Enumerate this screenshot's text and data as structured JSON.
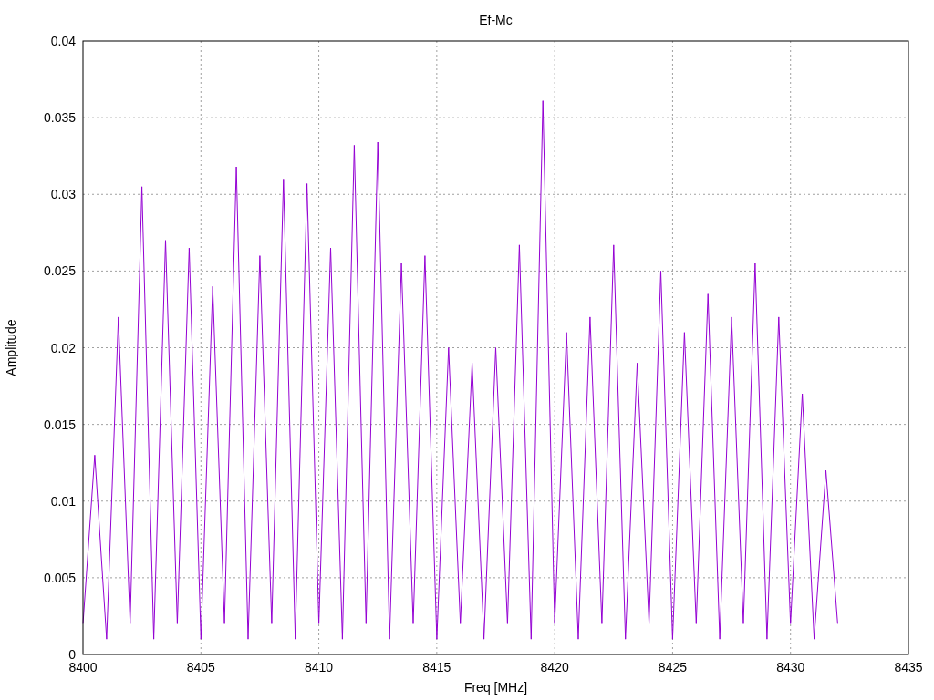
{
  "chart_data": {
    "type": "line",
    "title": "Ef-Mc",
    "xlabel": "Freq [MHz]",
    "ylabel": "Amplitude",
    "grid": true,
    "xlim": [
      8400,
      8435
    ],
    "ylim": [
      0,
      0.04
    ],
    "xticks": [
      8400,
      8405,
      8410,
      8415,
      8420,
      8425,
      8430,
      8435
    ],
    "yticks": [
      {
        "value": 0,
        "label": "0"
      },
      {
        "value": 0.005,
        "label": "0.005"
      },
      {
        "value": 0.01,
        "label": "0.01"
      },
      {
        "value": 0.015,
        "label": "0.015"
      },
      {
        "value": 0.02,
        "label": "0.02"
      },
      {
        "value": 0.025,
        "label": "0.025"
      },
      {
        "value": 0.03,
        "label": "0.03"
      },
      {
        "value": 0.035,
        "label": "0.035"
      },
      {
        "value": 0.04,
        "label": "0.04"
      }
    ],
    "x": [
      8400,
      8400.5,
      8401,
      8401.5,
      8402,
      8402.5,
      8403,
      8403.5,
      8404,
      8404.5,
      8405,
      8405.5,
      8406,
      8406.5,
      8407,
      8407.5,
      8408,
      8408.5,
      8409,
      8409.5,
      8410,
      8410.5,
      8411,
      8411.5,
      8412,
      8412.5,
      8413,
      8413.5,
      8414,
      8414.5,
      8415,
      8415.5,
      8416,
      8416.5,
      8417,
      8417.5,
      8418,
      8418.5,
      8419,
      8419.5,
      8420,
      8420.5,
      8421,
      8421.5,
      8422,
      8422.5,
      8423,
      8423.5,
      8424,
      8424.5,
      8425,
      8425.5,
      8426,
      8426.5,
      8427,
      8427.5,
      8428,
      8428.5,
      8429,
      8429.5,
      8430,
      8430.5,
      8431,
      8431.5,
      8432
    ],
    "series": [
      {
        "color": "#9400d3",
        "values": [
          0.002,
          0.013,
          0.001,
          0.022,
          0.002,
          0.0305,
          0.001,
          0.027,
          0.002,
          0.0265,
          0.001,
          0.024,
          0.002,
          0.0318,
          0.001,
          0.026,
          0.002,
          0.031,
          0.001,
          0.0307,
          0.002,
          0.0265,
          0.001,
          0.0332,
          0.002,
          0.0334,
          0.001,
          0.0255,
          0.002,
          0.026,
          0.001,
          0.02,
          0.002,
          0.019,
          0.001,
          0.02,
          0.002,
          0.0267,
          0.001,
          0.0361,
          0.002,
          0.021,
          0.001,
          0.022,
          0.002,
          0.0267,
          0.001,
          0.019,
          0.002,
          0.025,
          0.001,
          0.021,
          0.002,
          0.0235,
          0.001,
          0.022,
          0.002,
          0.0255,
          0.001,
          0.022,
          0.002,
          0.017,
          0.001,
          0.012,
          0.002
        ]
      }
    ]
  }
}
